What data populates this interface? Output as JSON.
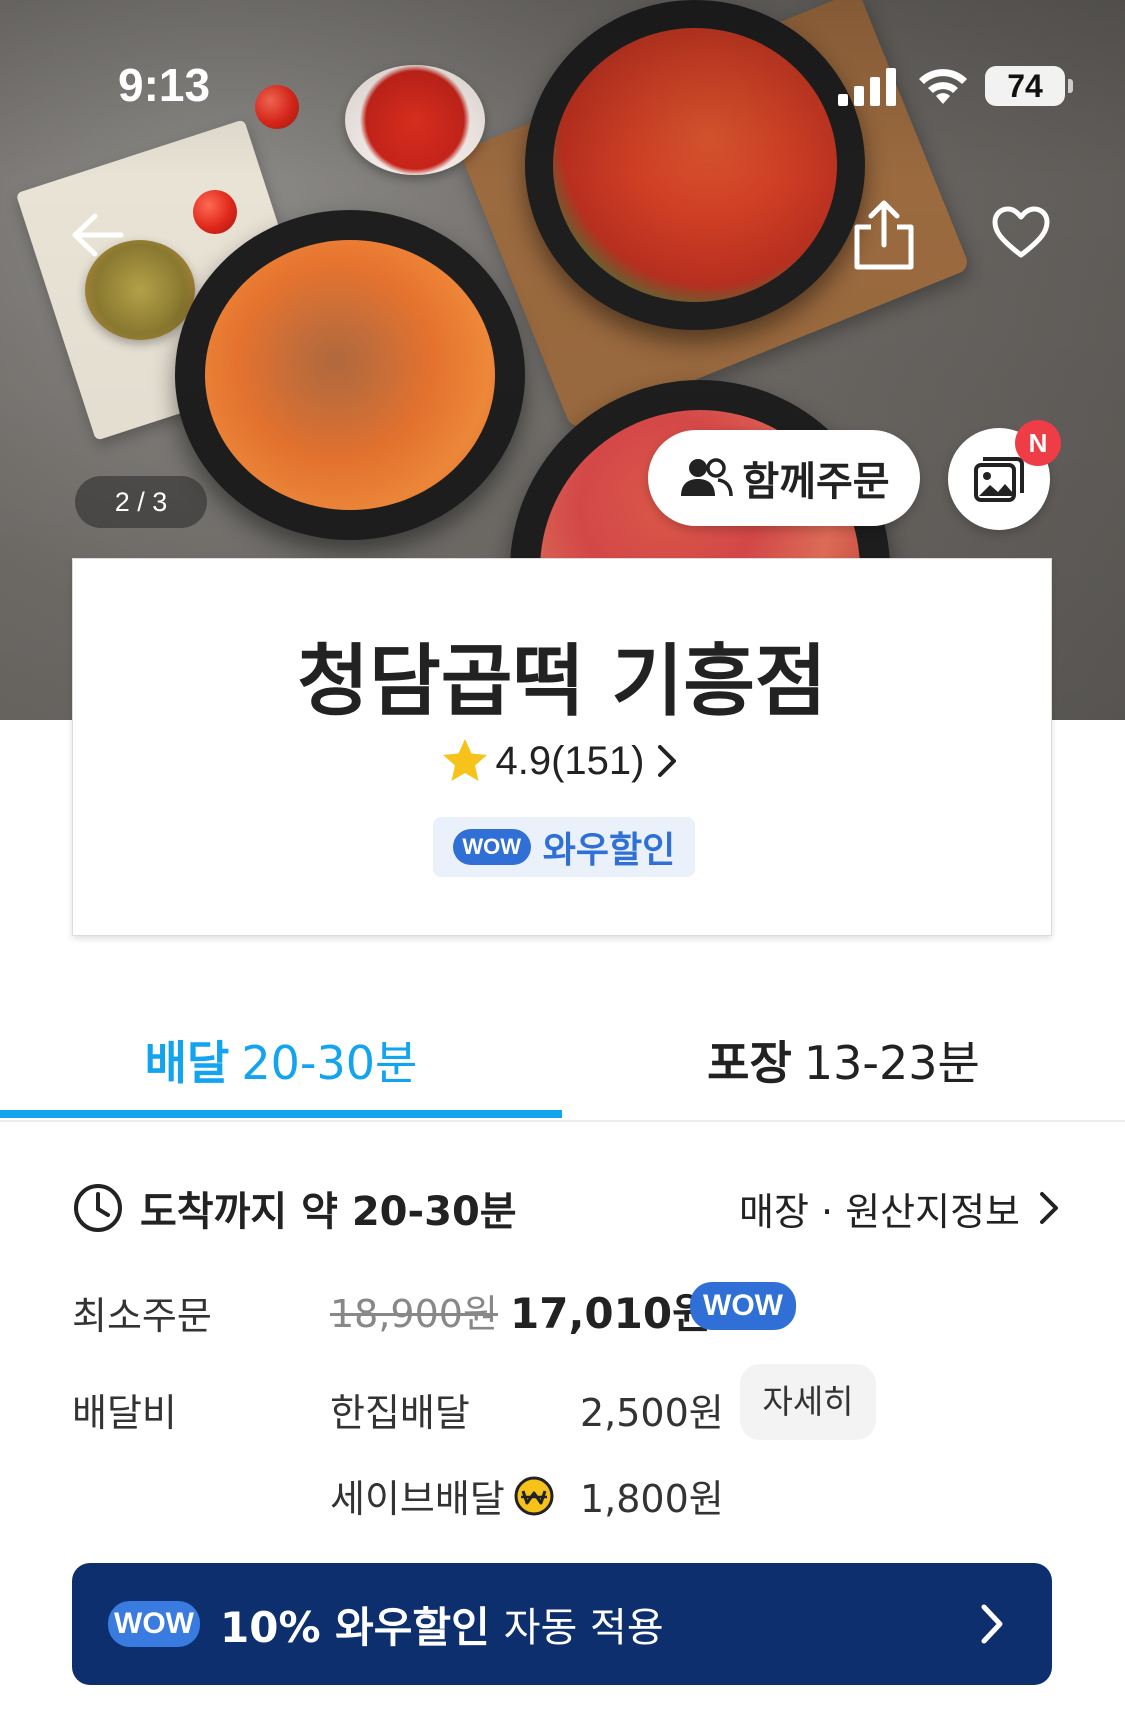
{
  "status_bar": {
    "time": "9:13",
    "battery": "74"
  },
  "hero": {
    "pager": "2 / 3",
    "group_order_label": "함께주문",
    "new_badge": "N"
  },
  "store": {
    "name": "청담곱떡 기흥점",
    "rating": "4.9(151)",
    "wow_badge": "WOW",
    "wow_label": "와우할인"
  },
  "tabs": [
    {
      "label": "배달",
      "time": "20-30분",
      "active": true
    },
    {
      "label": "포장",
      "time": "13-23분",
      "active": false
    }
  ],
  "info": {
    "eta": "도착까지 약 20-30분",
    "store_info_link": "매장 · 원산지정보",
    "min_order_label": "최소주문",
    "min_order_original": "18,900원",
    "min_order_discounted": "17,010원",
    "min_order_wow": "WOW",
    "delivery_fee_label": "배달비",
    "fee_options": [
      {
        "type": "한집배달",
        "price": "2,500원",
        "detail_button": "자세히"
      },
      {
        "type": "세이브배달",
        "price": "1,800원"
      }
    ]
  },
  "wow_banner": {
    "badge": "WOW",
    "bold_text": "10% 와우할인",
    "rest_text": "자동 적용"
  },
  "colors": {
    "accent": "#13a4ef",
    "wow_blue": "#2f6fd6",
    "banner_navy": "#0e2f6e",
    "badge_red": "#ee3d46",
    "star_yellow": "#f7c31b"
  }
}
